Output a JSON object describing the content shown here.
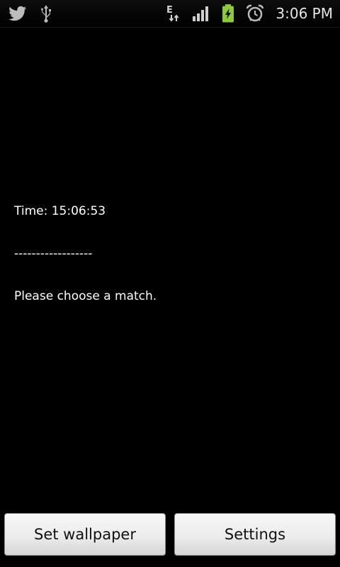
{
  "status_bar": {
    "time": "3:06 PM",
    "network_type": "E",
    "icons": {
      "left": [
        "twitter-icon",
        "usb-icon"
      ],
      "right": [
        "edge-data-icon",
        "signal-icon",
        "battery-charging-icon",
        "alarm-icon"
      ]
    },
    "colors": {
      "battery": "#8dc63f",
      "icon": "#bdbdbd"
    }
  },
  "content": {
    "time_line": "Time: 15:06:53",
    "separator": "------------------",
    "message": "Please choose a match."
  },
  "buttons": {
    "set_wallpaper": "Set wallpaper",
    "settings": "Settings"
  }
}
